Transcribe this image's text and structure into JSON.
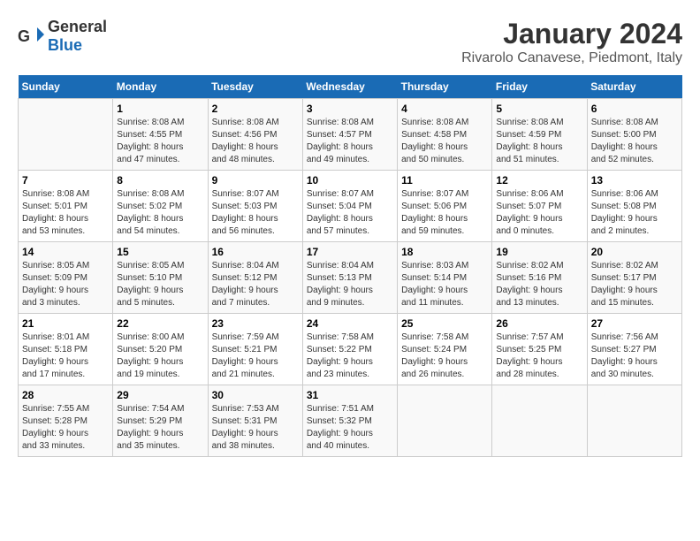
{
  "header": {
    "logo_general": "General",
    "logo_blue": "Blue",
    "title": "January 2024",
    "subtitle": "Rivarolo Canavese, Piedmont, Italy"
  },
  "calendar": {
    "days_of_week": [
      "Sunday",
      "Monday",
      "Tuesday",
      "Wednesday",
      "Thursday",
      "Friday",
      "Saturday"
    ],
    "weeks": [
      [
        {
          "day": "",
          "info": ""
        },
        {
          "day": "1",
          "info": "Sunrise: 8:08 AM\nSunset: 4:55 PM\nDaylight: 8 hours\nand 47 minutes."
        },
        {
          "day": "2",
          "info": "Sunrise: 8:08 AM\nSunset: 4:56 PM\nDaylight: 8 hours\nand 48 minutes."
        },
        {
          "day": "3",
          "info": "Sunrise: 8:08 AM\nSunset: 4:57 PM\nDaylight: 8 hours\nand 49 minutes."
        },
        {
          "day": "4",
          "info": "Sunrise: 8:08 AM\nSunset: 4:58 PM\nDaylight: 8 hours\nand 50 minutes."
        },
        {
          "day": "5",
          "info": "Sunrise: 8:08 AM\nSunset: 4:59 PM\nDaylight: 8 hours\nand 51 minutes."
        },
        {
          "day": "6",
          "info": "Sunrise: 8:08 AM\nSunset: 5:00 PM\nDaylight: 8 hours\nand 52 minutes."
        }
      ],
      [
        {
          "day": "7",
          "info": "Sunrise: 8:08 AM\nSunset: 5:01 PM\nDaylight: 8 hours\nand 53 minutes."
        },
        {
          "day": "8",
          "info": "Sunrise: 8:08 AM\nSunset: 5:02 PM\nDaylight: 8 hours\nand 54 minutes."
        },
        {
          "day": "9",
          "info": "Sunrise: 8:07 AM\nSunset: 5:03 PM\nDaylight: 8 hours\nand 56 minutes."
        },
        {
          "day": "10",
          "info": "Sunrise: 8:07 AM\nSunset: 5:04 PM\nDaylight: 8 hours\nand 57 minutes."
        },
        {
          "day": "11",
          "info": "Sunrise: 8:07 AM\nSunset: 5:06 PM\nDaylight: 8 hours\nand 59 minutes."
        },
        {
          "day": "12",
          "info": "Sunrise: 8:06 AM\nSunset: 5:07 PM\nDaylight: 9 hours\nand 0 minutes."
        },
        {
          "day": "13",
          "info": "Sunrise: 8:06 AM\nSunset: 5:08 PM\nDaylight: 9 hours\nand 2 minutes."
        }
      ],
      [
        {
          "day": "14",
          "info": "Sunrise: 8:05 AM\nSunset: 5:09 PM\nDaylight: 9 hours\nand 3 minutes."
        },
        {
          "day": "15",
          "info": "Sunrise: 8:05 AM\nSunset: 5:10 PM\nDaylight: 9 hours\nand 5 minutes."
        },
        {
          "day": "16",
          "info": "Sunrise: 8:04 AM\nSunset: 5:12 PM\nDaylight: 9 hours\nand 7 minutes."
        },
        {
          "day": "17",
          "info": "Sunrise: 8:04 AM\nSunset: 5:13 PM\nDaylight: 9 hours\nand 9 minutes."
        },
        {
          "day": "18",
          "info": "Sunrise: 8:03 AM\nSunset: 5:14 PM\nDaylight: 9 hours\nand 11 minutes."
        },
        {
          "day": "19",
          "info": "Sunrise: 8:02 AM\nSunset: 5:16 PM\nDaylight: 9 hours\nand 13 minutes."
        },
        {
          "day": "20",
          "info": "Sunrise: 8:02 AM\nSunset: 5:17 PM\nDaylight: 9 hours\nand 15 minutes."
        }
      ],
      [
        {
          "day": "21",
          "info": "Sunrise: 8:01 AM\nSunset: 5:18 PM\nDaylight: 9 hours\nand 17 minutes."
        },
        {
          "day": "22",
          "info": "Sunrise: 8:00 AM\nSunset: 5:20 PM\nDaylight: 9 hours\nand 19 minutes."
        },
        {
          "day": "23",
          "info": "Sunrise: 7:59 AM\nSunset: 5:21 PM\nDaylight: 9 hours\nand 21 minutes."
        },
        {
          "day": "24",
          "info": "Sunrise: 7:58 AM\nSunset: 5:22 PM\nDaylight: 9 hours\nand 23 minutes."
        },
        {
          "day": "25",
          "info": "Sunrise: 7:58 AM\nSunset: 5:24 PM\nDaylight: 9 hours\nand 26 minutes."
        },
        {
          "day": "26",
          "info": "Sunrise: 7:57 AM\nSunset: 5:25 PM\nDaylight: 9 hours\nand 28 minutes."
        },
        {
          "day": "27",
          "info": "Sunrise: 7:56 AM\nSunset: 5:27 PM\nDaylight: 9 hours\nand 30 minutes."
        }
      ],
      [
        {
          "day": "28",
          "info": "Sunrise: 7:55 AM\nSunset: 5:28 PM\nDaylight: 9 hours\nand 33 minutes."
        },
        {
          "day": "29",
          "info": "Sunrise: 7:54 AM\nSunset: 5:29 PM\nDaylight: 9 hours\nand 35 minutes."
        },
        {
          "day": "30",
          "info": "Sunrise: 7:53 AM\nSunset: 5:31 PM\nDaylight: 9 hours\nand 38 minutes."
        },
        {
          "day": "31",
          "info": "Sunrise: 7:51 AM\nSunset: 5:32 PM\nDaylight: 9 hours\nand 40 minutes."
        },
        {
          "day": "",
          "info": ""
        },
        {
          "day": "",
          "info": ""
        },
        {
          "day": "",
          "info": ""
        }
      ]
    ]
  }
}
